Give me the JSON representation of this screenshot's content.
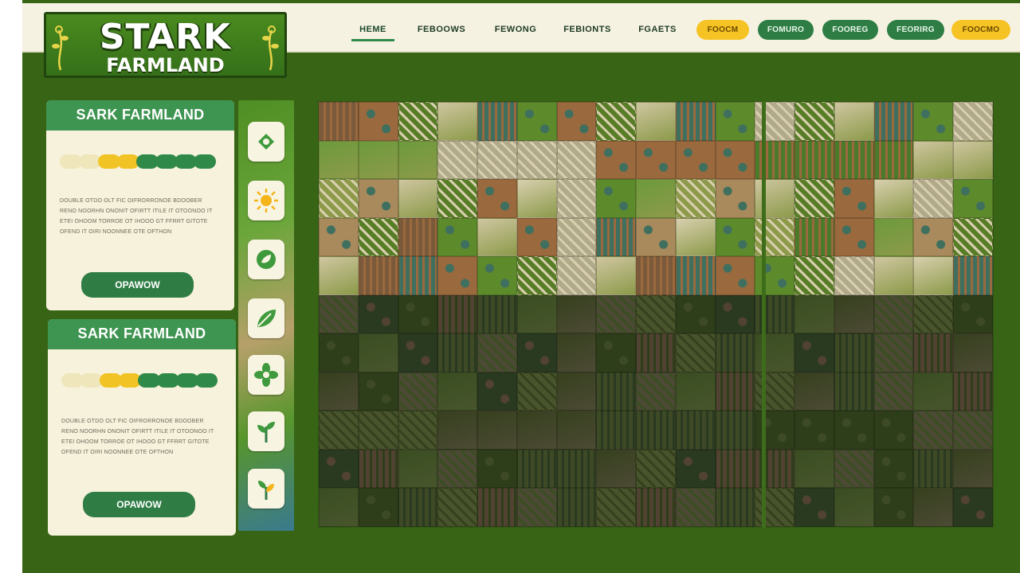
{
  "logo": {
    "title": "STARK",
    "subtitle": "FARMLAND"
  },
  "nav": [
    {
      "label": "HEME",
      "active": true
    },
    {
      "label": "FEBOOWS",
      "active": false
    },
    {
      "label": "FEWONG",
      "active": false
    },
    {
      "label": "FEBIONTS",
      "active": false
    },
    {
      "label": "FGAETS",
      "active": false
    }
  ],
  "pills": [
    {
      "label": "FOOCM",
      "color": "yellow"
    },
    {
      "label": "FOMURO",
      "color": "green"
    },
    {
      "label": "FOOREG",
      "color": "green"
    },
    {
      "label": "FEORIRG",
      "color": "green"
    },
    {
      "label": "FOOCMO",
      "color": "yellow"
    }
  ],
  "cards": [
    {
      "title": "SARK FARMLAND",
      "text": "DOUBLE OTDO OLT FIC OIFRORRONOE BDOOBER RENO NOORHN ONONIT OFIRTT ITILE IT OTOONOO IT ETEI OHOOM TORROE OT IHOOO GT FFRRT GITOTE OFEND IT OIRI NOONNEE OTE OFTHON",
      "button": "OPAWOW"
    },
    {
      "title": "SARK FARMLAND",
      "text": "DOUBLE OTDO OLT FIC OIFRORRONOE BDOOBER RENO NOORHN ONONIT OFIRTT ITILE IT OTOONOO IT ETEI OHOOM TORROE OT IHOOO GT FFRRT GITOTE OFEND IT OIRI NOONNEE OTE OFTHON",
      "button": "OPAWOW"
    }
  ],
  "progress_dots": [
    "#efe7bb",
    "#efe7bb",
    "#f2c324",
    "#f2c324",
    "#2f8a4a",
    "#2f8a4a",
    "#2f8a4a",
    "#2f8a4a"
  ],
  "strip_icons": [
    "seed-icon",
    "sun-icon",
    "circle-leaf-icon",
    "leaf-icon",
    "flower-icon",
    "plant-icon",
    "sprout-icon"
  ],
  "colors": {
    "background": "#376515",
    "header_bg": "#f6f2e2",
    "card_bg": "#f7f2dc",
    "card_header": "#3e9451",
    "button_green": "#2f7d45",
    "accent_yellow": "#f6c324"
  },
  "tile_palette": [
    "#7a5a3a",
    "#5d8b2c",
    "#8c9a4a",
    "#cfc6a0",
    "#4a7a2a",
    "#9a6a3e",
    "#b0a98a",
    "#6d9a3c",
    "#3f6f5e",
    "#a98a5c",
    "#577d26",
    "#d8cfae"
  ],
  "tile_palette_dark": [
    "#3e4a26",
    "#2e3e1a",
    "#4c4a34",
    "#3a4e22",
    "#524232",
    "#2a3a20",
    "#48552c",
    "#36401e"
  ]
}
